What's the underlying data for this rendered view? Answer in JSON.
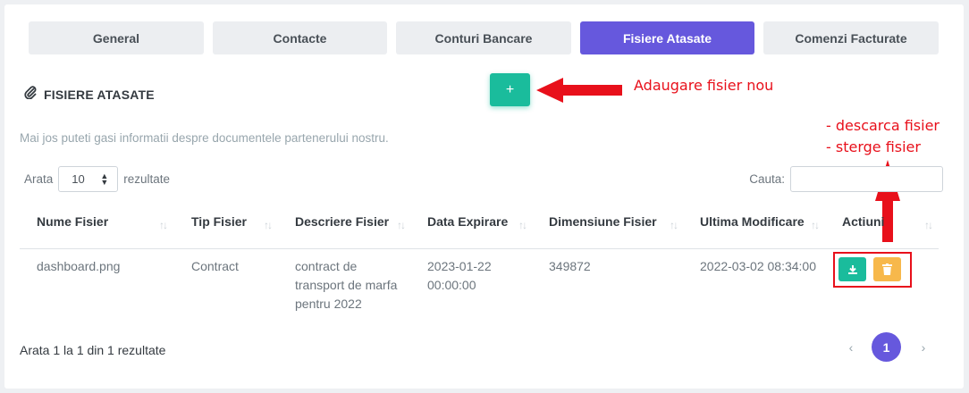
{
  "tabs": [
    {
      "label": "General",
      "active": false
    },
    {
      "label": "Contacte",
      "active": false
    },
    {
      "label": "Conturi Bancare",
      "active": false
    },
    {
      "label": "Fisiere Atasate",
      "active": true
    },
    {
      "label": "Comenzi Facturate",
      "active": false
    }
  ],
  "section": {
    "icon": "paperclip-icon",
    "title": "FISIERE ATASATE",
    "add_label": "+"
  },
  "annotations": {
    "add": "Adaugare fisier nou",
    "download": "- descarca fisier",
    "delete": "- sterge fisier"
  },
  "description": "Mai jos puteti gasi informatii despre documentele partenerului nostru.",
  "length": {
    "prefix": "Arata",
    "value": "10",
    "suffix": "rezultate"
  },
  "search": {
    "label": "Cauta:",
    "value": ""
  },
  "table": {
    "columns": [
      "Nume Fisier",
      "Tip Fisier",
      "Descriere Fisier",
      "Data Expirare",
      "Dimensiune Fisier",
      "Ultima Modificare",
      "Actiuni"
    ],
    "rows": [
      {
        "name": "dashboard.png",
        "type": "Contract",
        "description": [
          "contract de",
          "transport de marfa",
          "pentru 2022"
        ],
        "expiry": [
          "2023-01-22",
          "00:00:00"
        ],
        "size": "349872",
        "modified": "2022-03-02 08:34:00"
      }
    ]
  },
  "footer": {
    "info": "Arata 1 la 1 din 1 rezultate",
    "prev": "‹",
    "page": "1",
    "next": "›"
  },
  "colors": {
    "primary": "#6658dd",
    "success": "#1abc9c",
    "warning": "#f7b84b",
    "annotation": "#e8101b"
  }
}
